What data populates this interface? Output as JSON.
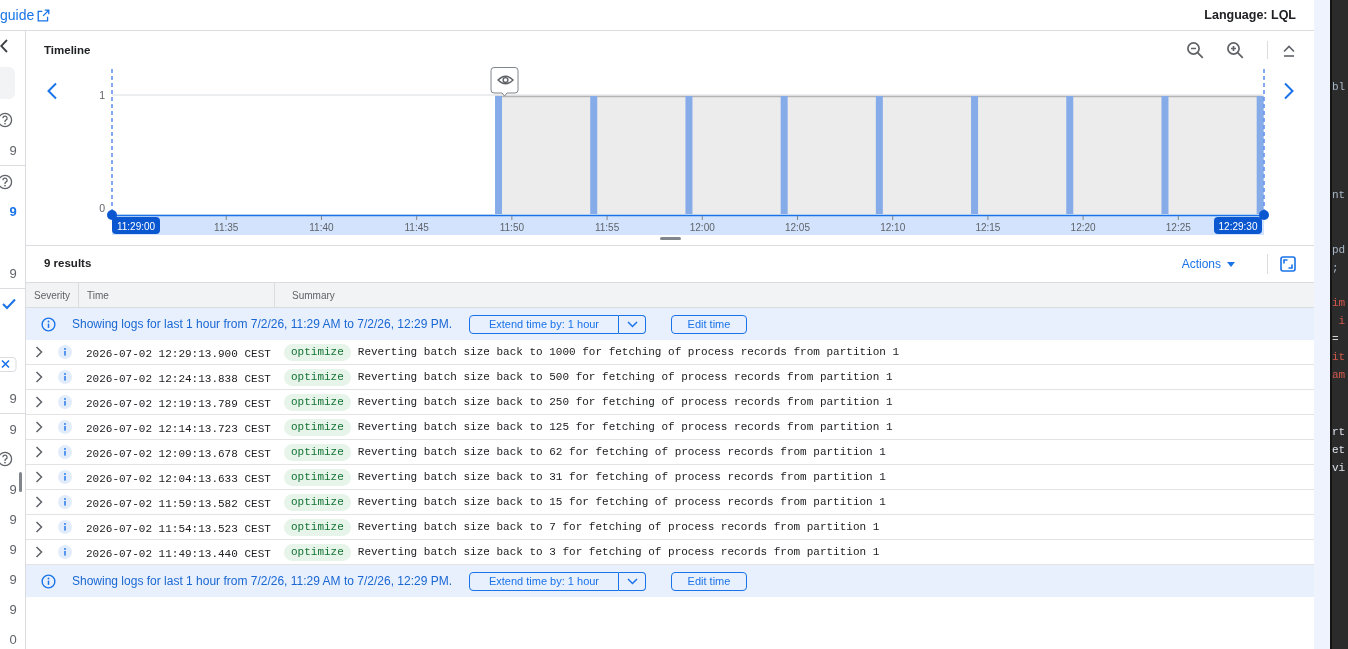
{
  "top_bar": {
    "link": "guide",
    "language": "Language: LQL"
  },
  "side_panel": {
    "groups": [
      {
        "items": [
          {
            "kind": "back"
          },
          {
            "kind": "field"
          },
          {
            "kind": "help"
          },
          {
            "kind": "count",
            "text": "9",
            "selected": false
          }
        ]
      },
      {
        "items": [
          {
            "kind": "help"
          },
          {
            "kind": "count",
            "text": "9",
            "selected": true
          },
          {
            "kind": "count",
            "text": "9",
            "selected": false
          }
        ]
      },
      {
        "items": [
          {
            "kind": "check"
          },
          {
            "kind": "clear"
          },
          {
            "kind": "count",
            "text": "9",
            "selected": false
          }
        ]
      },
      {
        "items": [
          {
            "kind": "count",
            "text": "9",
            "selected": false
          },
          {
            "kind": "help"
          },
          {
            "kind": "count",
            "text": "9",
            "selected": false
          },
          {
            "kind": "count",
            "text": "9",
            "selected": false
          },
          {
            "kind": "count",
            "text": "9",
            "selected": false
          },
          {
            "kind": "count",
            "text": "9",
            "selected": false
          },
          {
            "kind": "count",
            "text": "9",
            "selected": false
          },
          {
            "kind": "count",
            "text": "0",
            "selected": false
          }
        ]
      }
    ]
  },
  "timeline": {
    "title": "Timeline",
    "range_start": "11:29:00",
    "range_end": "12:29:30",
    "chart_data": {
      "type": "bar",
      "categories": [
        null,
        null,
        null,
        null,
        null,
        null,
        "11:35",
        null,
        null,
        null,
        null,
        "11:40",
        null,
        null,
        null,
        null,
        "11:45",
        null,
        null,
        null,
        null,
        "11:50",
        null,
        null,
        null,
        null,
        "11:55",
        null,
        null,
        null,
        null,
        "12:00",
        null,
        null,
        null,
        null,
        "12:05",
        null,
        null,
        null,
        null,
        "12:10",
        null,
        null,
        null,
        null,
        "12:15",
        null,
        null,
        null,
        null,
        "12:20",
        null,
        null,
        null,
        null,
        "12:25",
        null,
        null,
        null,
        null
      ],
      "values": [
        null,
        null,
        null,
        null,
        null,
        null,
        null,
        null,
        null,
        null,
        null,
        null,
        null,
        null,
        null,
        null,
        null,
        null,
        null,
        null,
        1,
        null,
        null,
        null,
        null,
        1,
        null,
        null,
        null,
        null,
        1,
        null,
        null,
        null,
        null,
        1,
        null,
        null,
        null,
        null,
        1,
        null,
        null,
        null,
        null,
        1,
        null,
        null,
        null,
        null,
        1,
        null,
        null,
        null,
        null,
        1,
        null,
        null,
        null,
        null,
        1
      ],
      "ylim": [
        0,
        1
      ],
      "yticks": [
        0,
        1
      ]
    }
  },
  "results": {
    "count": "9 results",
    "actions": "Actions"
  },
  "table": {
    "columns": [
      "Severity",
      "Time",
      "Summary"
    ],
    "top_notice": {
      "text": "Showing logs for last 1 hour from 7/2/26, 11:29 AM to 7/2/26, 12:29 PM.",
      "extend_button": "Extend time by: 1 hour",
      "edit_button": "Edit time"
    },
    "rows": [
      {
        "kind": "info",
        "expanded": false,
        "time": "2026-07-02 12:29:13.900 CEST",
        "tag": "optimize",
        "summary": "Reverting batch size back to 1000 for fetching of process records from partition 1"
      },
      {
        "kind": "info",
        "expanded": false,
        "time": "2026-07-02 12:24:13.838 CEST",
        "tag": "optimize",
        "summary": "Reverting batch size back to 500 for fetching of process records from partition 1"
      },
      {
        "kind": "info",
        "expanded": false,
        "time": "2026-07-02 12:19:13.789 CEST",
        "tag": "optimize",
        "summary": "Reverting batch size back to 250 for fetching of process records from partition 1"
      },
      {
        "kind": "info",
        "expanded": false,
        "time": "2026-07-02 12:14:13.723 CEST",
        "tag": "optimize",
        "summary": "Reverting batch size back to 125 for fetching of process records from partition 1"
      },
      {
        "kind": "info",
        "expanded": false,
        "time": "2026-07-02 12:09:13.678 CEST",
        "tag": "optimize",
        "summary": "Reverting batch size back to 62 for fetching of process records from partition 1"
      },
      {
        "kind": "info",
        "expanded": false,
        "time": "2026-07-02 12:04:13.633 CEST",
        "tag": "optimize",
        "summary": "Reverting batch size back to 31 for fetching of process records from partition 1"
      },
      {
        "kind": "info",
        "expanded": false,
        "time": "2026-07-02 11:59:13.582 CEST",
        "tag": "optimize",
        "summary": "Reverting batch size back to 15 for fetching of process records from partition 1"
      },
      {
        "kind": "info",
        "expanded": false,
        "time": "2026-07-02 11:54:13.523 CEST",
        "tag": "optimize",
        "summary": "Reverting batch size back to 7 for fetching of process records from partition 1"
      },
      {
        "kind": "info",
        "expanded": false,
        "time": "2026-07-02 11:49:13.440 CEST",
        "tag": "optimize",
        "summary": "Reverting batch size back to 3 for fetching of process records from partition 1"
      }
    ],
    "bottom_notice": {
      "text": "Showing logs for last 1 hour from 7/2/26, 11:29 AM to 7/2/26, 12:29 PM.",
      "extend_button": "Extend time by: 1 hour",
      "edit_button": "Edit time"
    }
  },
  "code_editor": {
    "blocks": [
      {
        "lines": [
          {
            "text": "bl",
            "kind": "plain"
          }
        ]
      },
      {
        "lines": [
          {
            "text": "nt",
            "kind": "plain"
          }
        ]
      },
      {
        "lines": [
          {
            "text": "pd",
            "kind": "plain"
          },
          {
            "text": ";",
            "kind": "plain"
          }
        ]
      },
      {
        "lines": [
          {
            "text": "im",
            "kind": "keyword"
          },
          {
            "text": " i",
            "kind": "keyword"
          },
          {
            "text": "=",
            "kind": "operator"
          },
          {
            "text": "it",
            "kind": "keyword"
          },
          {
            "text": "am",
            "kind": "keyword"
          }
        ]
      },
      {
        "lines": [
          {
            "text": "rt",
            "kind": "bright"
          },
          {
            "text": "et",
            "kind": "bright"
          },
          {
            "text": "vi",
            "kind": "bright"
          }
        ]
      }
    ]
  }
}
